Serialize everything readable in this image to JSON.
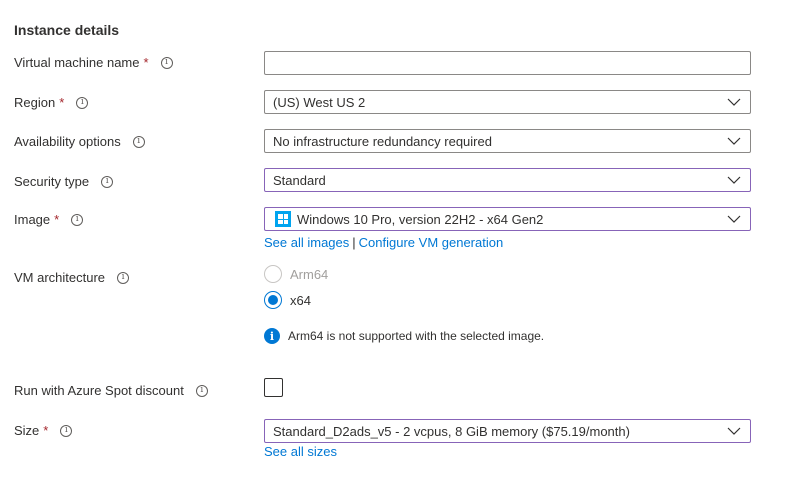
{
  "section": {
    "title": "Instance details"
  },
  "fields": {
    "vm_name": {
      "label": "Virtual machine name",
      "required": "*",
      "value": "",
      "placeholder": ""
    },
    "region": {
      "label": "Region",
      "required": "*",
      "value": "(US) West US 2"
    },
    "availability": {
      "label": "Availability options",
      "value": "No infrastructure redundancy required"
    },
    "security": {
      "label": "Security type",
      "value": "Standard"
    },
    "image": {
      "label": "Image",
      "required": "*",
      "value": "Windows 10 Pro, version 22H2 - x64 Gen2",
      "link_all": "See all images",
      "link_separator": "|",
      "link_configure": "Configure VM generation"
    },
    "architecture": {
      "label": "VM architecture",
      "options": [
        {
          "label": "Arm64",
          "checked": false,
          "disabled": true
        },
        {
          "label": "x64",
          "checked": true,
          "disabled": false
        }
      ],
      "info_message": "Arm64 is not supported with the selected image."
    },
    "spot": {
      "label": "Run with Azure Spot discount",
      "checked": false
    },
    "size": {
      "label": "Size",
      "required": "*",
      "value": "Standard_D2ads_v5 - 2 vcpus, 8 GiB memory ($75.19/month)",
      "link_all": "See all sizes"
    }
  },
  "icons": {
    "info": "info-icon",
    "chevron": "chevron-down-icon",
    "windows": "windows-logo-icon",
    "info_filled": "info-filled-icon"
  },
  "colors": {
    "accent": "#0078d4",
    "required": "#a4262c",
    "focus_border": "#8764b8",
    "border": "#8a8886"
  }
}
